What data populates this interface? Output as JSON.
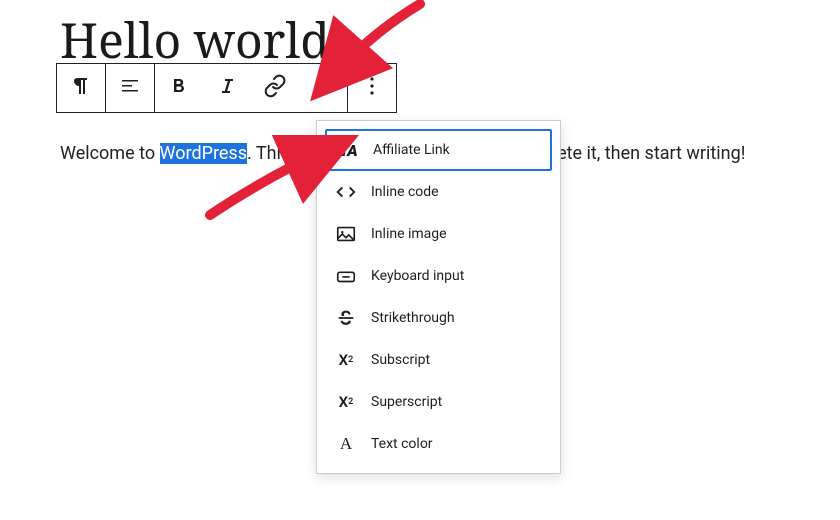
{
  "title": "Hello world!",
  "paragraph": {
    "pre": "Welcome to ",
    "highlight": "WordPress",
    "mid": ". This",
    "post": "elete it, then start writing!"
  },
  "dropdown": {
    "items": [
      {
        "label": "Affiliate Link",
        "highlight": true
      },
      {
        "label": "Inline code"
      },
      {
        "label": "Inline image"
      },
      {
        "label": "Keyboard input"
      },
      {
        "label": "Strikethrough"
      },
      {
        "label": "Subscript"
      },
      {
        "label": "Superscript"
      },
      {
        "label": "Text color"
      }
    ]
  }
}
